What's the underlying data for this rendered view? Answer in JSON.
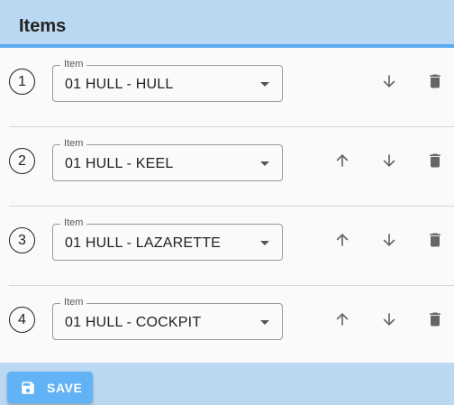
{
  "header": {
    "title": "Items"
  },
  "items": [
    {
      "number": "1",
      "label": "Item",
      "value": "01 HULL - HULL",
      "show_up": false
    },
    {
      "number": "2",
      "label": "Item",
      "value": "01 HULL - KEEL",
      "show_up": true
    },
    {
      "number": "3",
      "label": "Item",
      "value": "01 HULL - LAZARETTE",
      "show_up": true
    },
    {
      "number": "4",
      "label": "Item",
      "value": "01 HULL - COCKPIT",
      "show_up": true
    }
  ],
  "footer": {
    "save_label": "SAVE"
  },
  "icons": {
    "up": "arrow-up-icon",
    "down": "arrow-down-icon",
    "delete": "trash-icon",
    "save": "floppy-disk-icon",
    "dropdown": "caret-down-icon"
  },
  "colors": {
    "header_bg": "#bad8f1",
    "header_border": "#5aabf0",
    "save_button": "#62b2f6"
  }
}
